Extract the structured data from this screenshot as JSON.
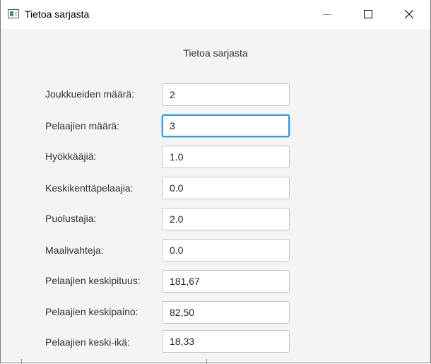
{
  "window": {
    "title": "Tietoa sarjasta",
    "icon": "app-window-icon",
    "controls": {
      "minimize": "minimize-icon",
      "maximize": "maximize-icon",
      "close": "close-icon"
    }
  },
  "heading": "Tietoa sarjasta",
  "fields": [
    {
      "label": "Joukkueiden määrä:",
      "value": "2"
    },
    {
      "label": "Pelaajien määrä:",
      "value": "3"
    },
    {
      "label": "Hyökkääjiä:",
      "value": "1.0"
    },
    {
      "label": "Keskikenttäpelaajia:",
      "value": "0.0"
    },
    {
      "label": "Puolustajia:",
      "value": "2.0"
    },
    {
      "label": "Maalivahteja:",
      "value": "0.0"
    },
    {
      "label": "Pelaajien keskipituus:",
      "value": "181,67"
    },
    {
      "label": "Pelaajien keskipaino:",
      "value": "82,50"
    },
    {
      "label": "Pelaajien keski-ikä:",
      "value": "18,33"
    }
  ],
  "colors": {
    "focus": "#3b9bd8",
    "background": "#f4f4f4"
  }
}
